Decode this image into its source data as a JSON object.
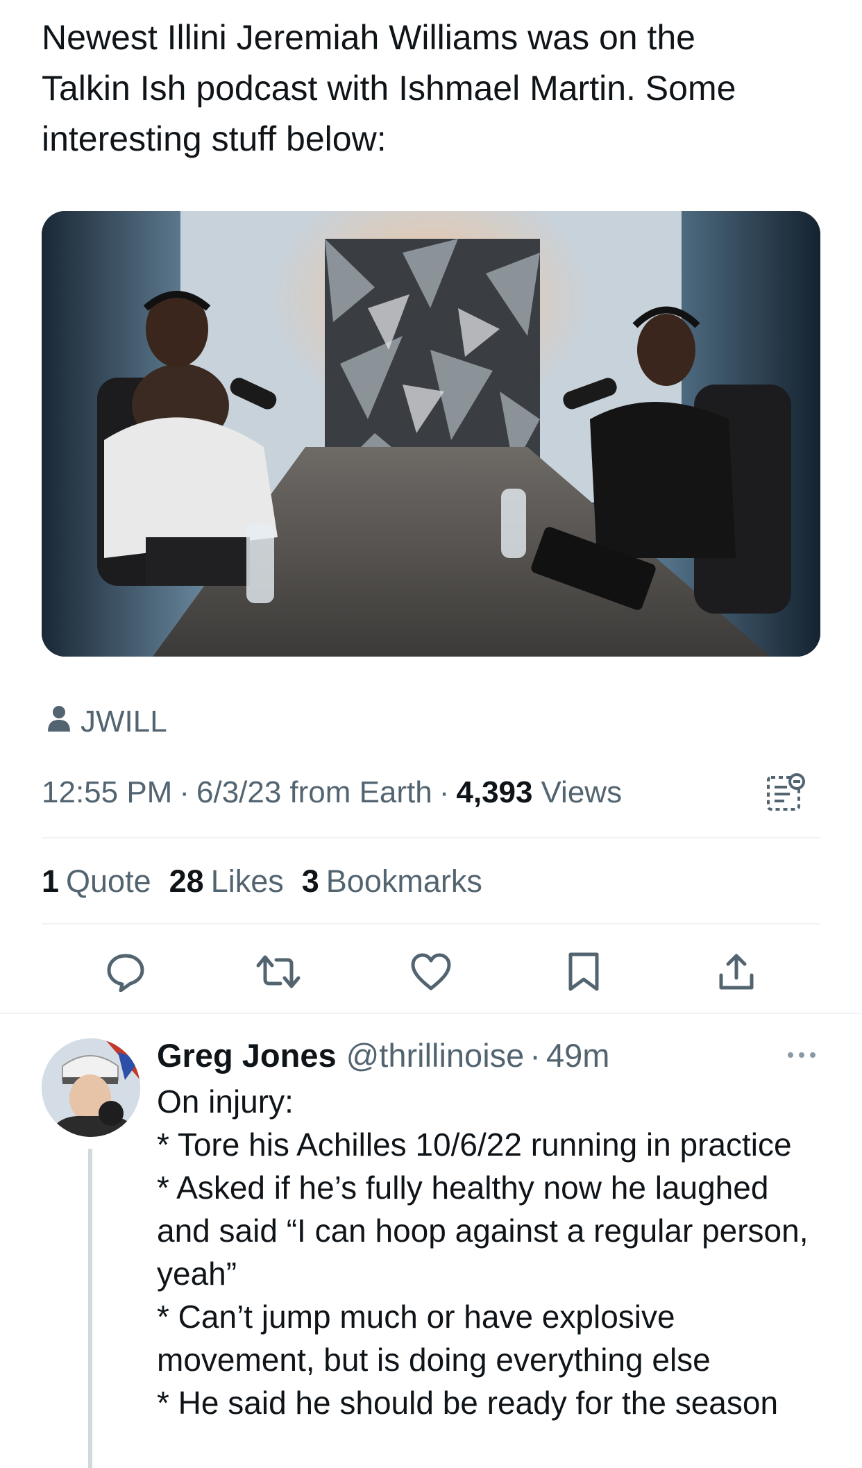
{
  "tweet": {
    "text": "Newest Illini Jeremiah Williams was on the\nTalkin Ish podcast with Ishmael Martin. Some\ninteresting stuff below:",
    "media_tag": "JWILL",
    "time": "12:55 PM",
    "sep1": "·",
    "date": "6/3/23",
    "source": "from Earth",
    "sep2": "·",
    "views_count": "4,393",
    "views_label": "Views"
  },
  "stats": {
    "quotes_count": "1",
    "quotes_label": "Quote",
    "likes_count": "28",
    "likes_label": "Likes",
    "bookmarks_count": "3",
    "bookmarks_label": "Bookmarks"
  },
  "actions": {
    "icons": [
      "reply-icon",
      "retweet-icon",
      "like-icon",
      "bookmark-icon",
      "share-icon"
    ]
  },
  "reply": {
    "name": "Greg Jones",
    "handle": "@thrillinoise",
    "sep": "·",
    "time": "49m",
    "lines": [
      "On injury:",
      "* Tore his Achilles 10/6/22 running in practice",
      "* Asked if he’s fully healthy now he laughed and said “I can hoop against a regular person, yeah”",
      "* Can’t jump much or have explosive movement, but is doing everything else",
      "* He said he should be ready for the season"
    ]
  },
  "colors": {
    "text_primary": "#0f1419",
    "text_secondary": "#536471",
    "divider": "#eff3f4",
    "thread_line": "#cfd9de"
  }
}
